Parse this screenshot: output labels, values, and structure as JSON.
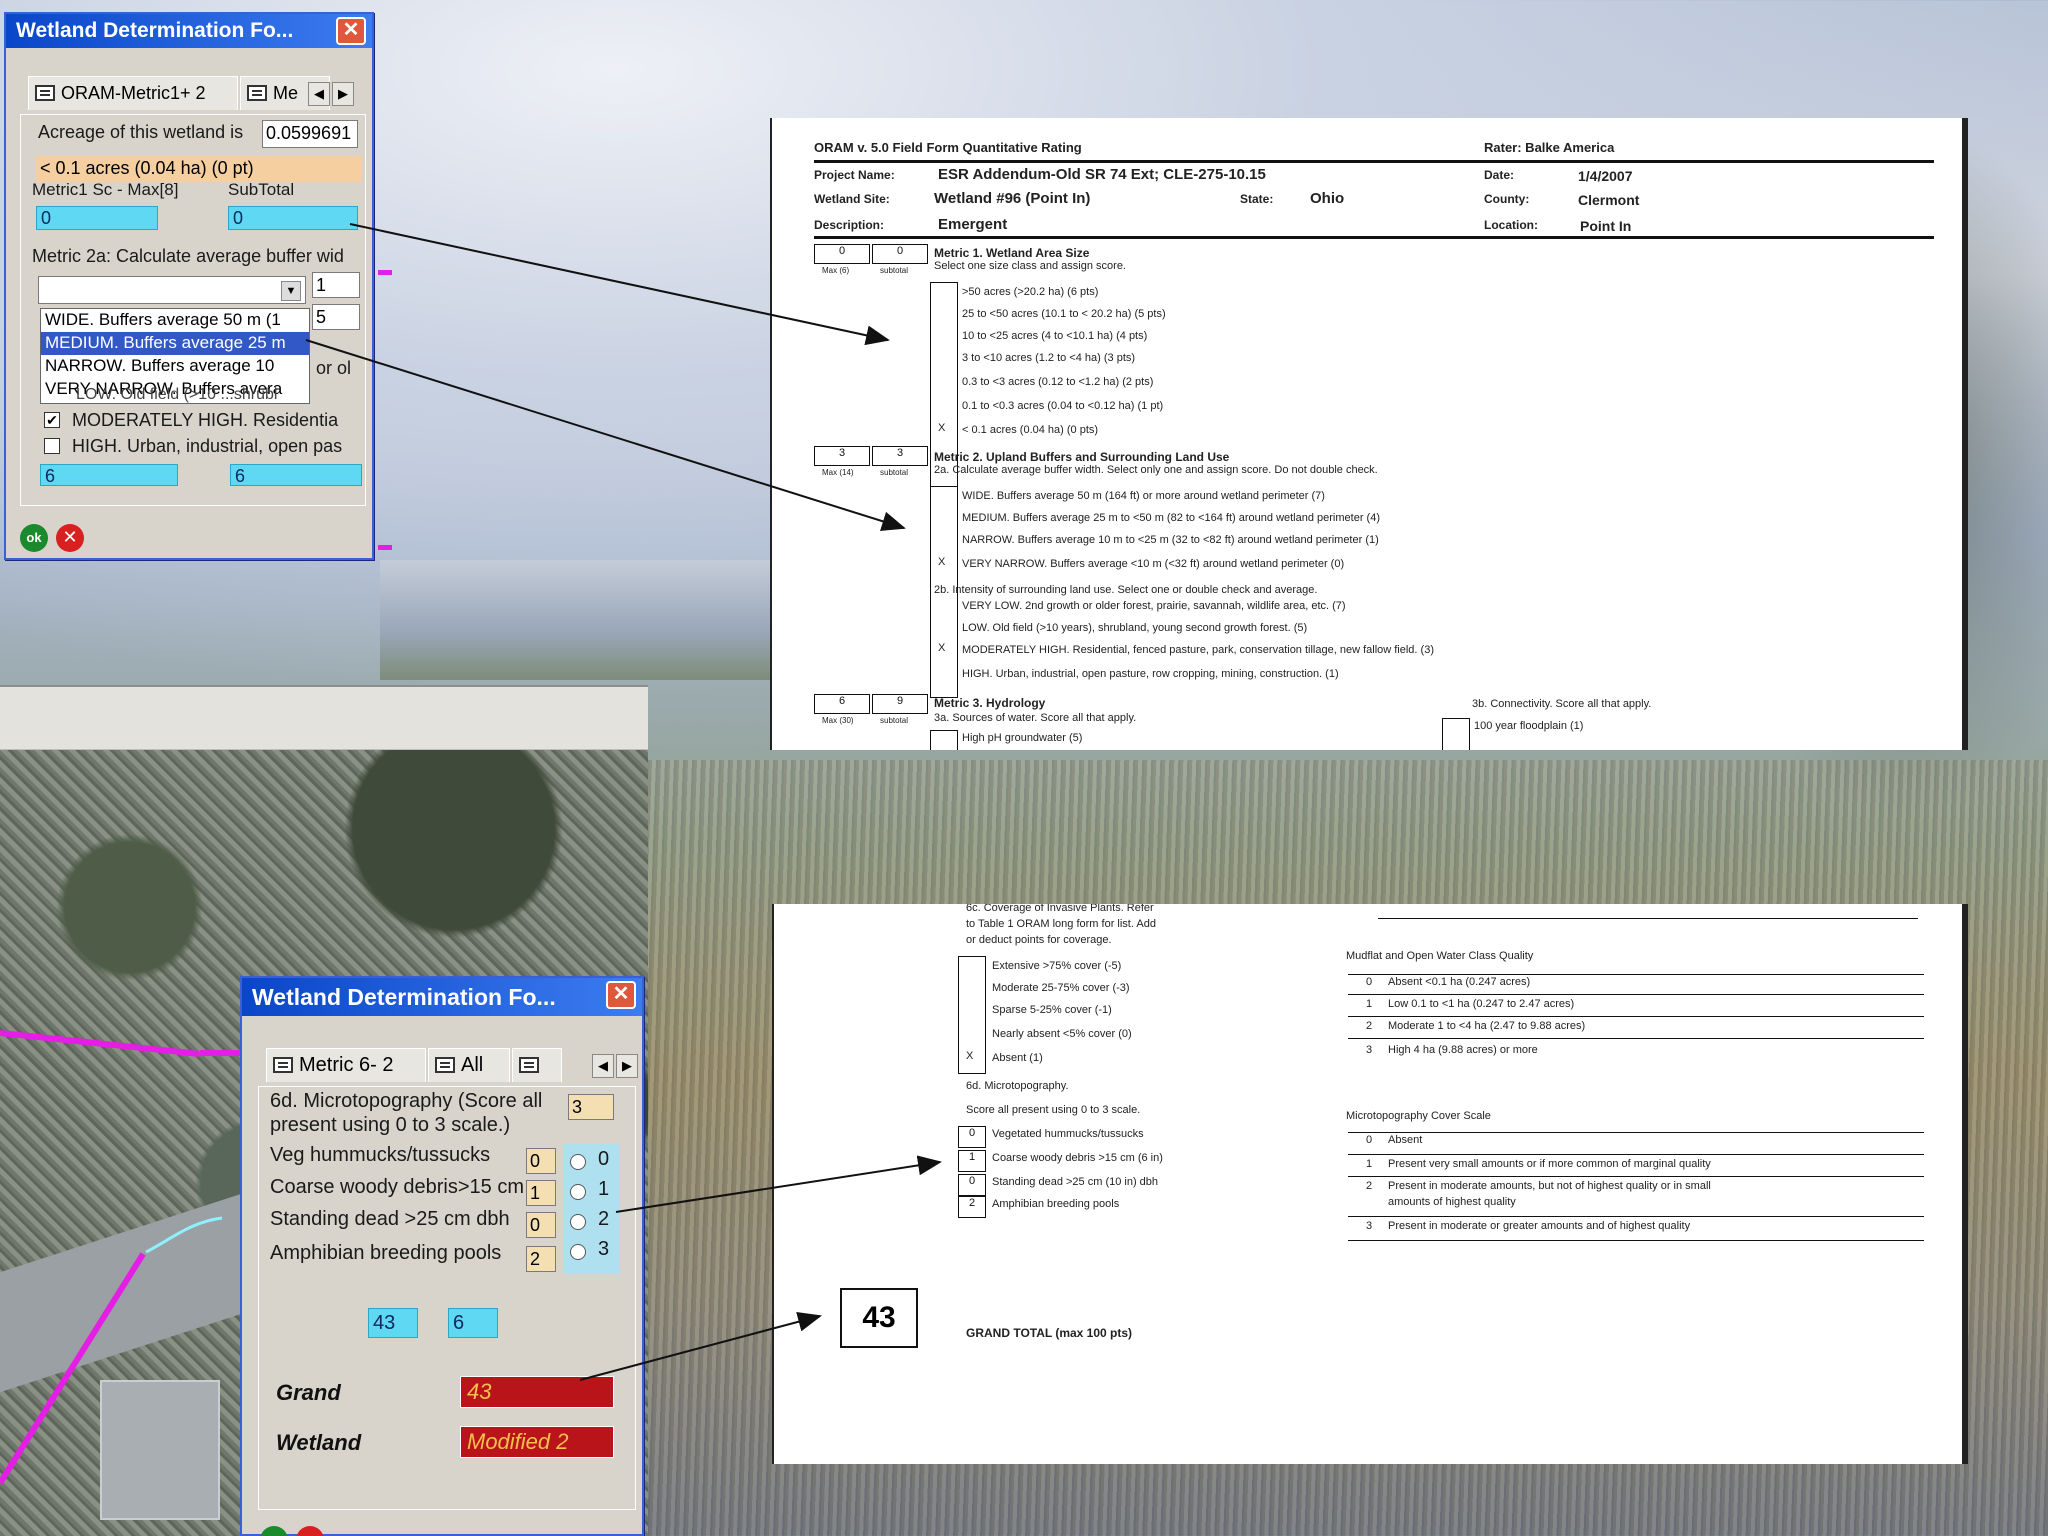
{
  "dialog1": {
    "title": "Wetland Determination Fo...",
    "close": "✕",
    "tab1": "ORAM-Metric1+ 2",
    "tab2": "Me",
    "acreage_label": "Acreage of this wetland is",
    "acreage_value": "0.0599691",
    "size_class": "< 0.1 acres (0.04 ha) (0 pt)",
    "m1_max_label": "Metric1 Sc - Max[8]",
    "subtotal_label": "SubTotal",
    "m1_score": "0",
    "subtotal_score": "0",
    "m2a_label": "Metric 2a: Calculate average buffer wid",
    "m2a_small1": "1",
    "m2a_small2": "5",
    "buffer_options": [
      "WIDE. Buffers average 50 m (1",
      "MEDIUM. Buffers average 25 m",
      "NARROW. Buffers average 10",
      "VERY NARROW. Buffers avera"
    ],
    "or_text": "or ol",
    "obscured_text": "LOW. Old field (>10 ...shrubl",
    "check1": "MODERATELY HIGH. Residentia",
    "check2": "HIGH. Urban, industrial, open pas",
    "score_a": "6",
    "score_b": "6",
    "ok": "ok",
    "cancel": "✕"
  },
  "dialog2": {
    "title": "Wetland Determination Fo...",
    "close": "✕",
    "tab1": "Metric 6- 2",
    "tab2": "All",
    "micro_label_1": "6d. Microtopography (Score all",
    "micro_label_2": "present using 0 to 3 scale.)",
    "micro_value": "3",
    "rows": [
      {
        "label": "Veg hummucks/tussucks",
        "value": "0",
        "radio": "0"
      },
      {
        "label": "Coarse woody debris>15 cm",
        "value": "1",
        "radio": "1"
      },
      {
        "label": "Standing dead >25 cm dbh",
        "value": "0",
        "radio": "2"
      },
      {
        "label": "Amphibian breeding pools",
        "value": "2",
        "radio": "3"
      }
    ],
    "total_a": "43",
    "total_b": "6",
    "grand_label": "Grand",
    "grand_value": "43",
    "wetland_label": "Wetland",
    "wetland_value": "Modified 2"
  },
  "form1": {
    "header": "ORAM v. 5.0 Field Form Quantitative Rating",
    "rater": "Rater: Balke America",
    "project_label": "Project Name:",
    "project_value": "ESR Addendum-Old SR 74 Ext; CLE-275-10.15",
    "date_label": "Date:",
    "date_value": "1/4/2007",
    "site_label": "Wetland Site:",
    "site_value": "Wetland #96 (Point In)",
    "state_label": "State:",
    "state_value": "Ohio",
    "county_label": "County:",
    "county_value": "Clermont",
    "desc_label": "Description:",
    "desc_value": "Emergent",
    "location_label": "Location:",
    "location_value": "Point In",
    "m1_box_a": "0",
    "m1_box_b": "0",
    "box_caption_a": "Max (6)",
    "box_caption_b": "subtotal",
    "m1_title": "Metric 1. Wetland Area Size",
    "m1_sub": "Select one size class and assign score.",
    "m1_items": [
      ">50 acres (>20.2 ha) (6 pts)",
      "25 to <50 acres (10.1 to < 20.2 ha) (5 pts)",
      "10 to <25 acres (4 to <10.1 ha) (4 pts)",
      "3 to <10 acres (1.2 to <4 ha) (3 pts)",
      "0.3 to <3 acres (0.12 to <1.2 ha) (2 pts)",
      "0.1 to <0.3 acres (0.04 to <0.12 ha) (1 pt)",
      "< 0.1 acres (0.04 ha) (0 pts)"
    ],
    "m1_mark": "X",
    "m2_box_a": "3",
    "m2_box_b": "3",
    "box_caption_m2": "Max (14)",
    "m2_title": "Metric 2. Upland Buffers and Surrounding Land Use",
    "m2_sub": "2a. Calculate average buffer width. Select only one and assign score. Do not double check.",
    "m2a_items": [
      "WIDE. Buffers average 50 m (164 ft) or more around wetland perimeter (7)",
      "MEDIUM. Buffers average 25 m to <50 m (82 to <164 ft) around wetland perimeter (4)",
      "NARROW. Buffers average 10 m to <25 m (32 to <82 ft) around wetland perimeter (1)",
      "VERY NARROW. Buffers average <10 m (<32 ft) around wetland perimeter (0)"
    ],
    "m2b_sub": "2b. Intensity of surrounding land use. Select one or double check and average.",
    "m2b_items": [
      "VERY LOW. 2nd growth or older forest, prairie, savannah, wildlife area, etc. (7)",
      "LOW. Old field (>10 years), shrubland, young second growth forest. (5)",
      "MODERATELY HIGH. Residential, fenced pasture, park, conservation tillage, new fallow field. (3)",
      "HIGH. Urban, industrial, open pasture, row cropping, mining, construction. (1)"
    ],
    "m3_box_a": "6",
    "m3_box_b": "9",
    "box_caption_m3": "Max (30)",
    "m3_title": "Metric 3. Hydrology",
    "m3_sub": "3a. Sources of water. Score all that apply.",
    "m3_item": "High pH groundwater (5)",
    "m3c_sub": "3b. Connectivity. Score all that apply.",
    "m3c_item": "100 year floodplain (1)"
  },
  "form2": {
    "m6c_lines": [
      "6c. Coverage of Invasive Plants. Refer",
      "to Table 1 ORAM long form for list. Add",
      "or deduct points for coverage."
    ],
    "m6c_items": [
      "Extensive >75% cover (-5)",
      "Moderate 25-75% cover (-3)",
      "Sparse 5-25% cover (-1)",
      "Nearly absent <5% cover (0)",
      "Absent (1)"
    ],
    "m6c_mark": "X",
    "m6d_title": "6d. Microtopography.",
    "m6d_sub": "Score all present using 0 to 3 scale.",
    "m6d_items": [
      {
        "score": "0",
        "label": "Vegetated hummucks/tussucks"
      },
      {
        "score": "1",
        "label": "Coarse woody debris >15 cm (6 in)"
      },
      {
        "score": "0",
        "label": "Standing dead >25 cm (10 in) dbh"
      },
      {
        "score": "2",
        "label": "Amphibian breeding pools"
      }
    ],
    "mudflat_title": "Mudflat and Open Water Class Quality",
    "mudflat_items": [
      {
        "n": "0",
        "t": "Absent <0.1 ha (0.247 acres)"
      },
      {
        "n": "1",
        "t": "Low 0.1 to <1 ha (0.247 to 2.47 acres)"
      },
      {
        "n": "2",
        "t": "Moderate 1 to <4 ha (2.47 to 9.88 acres)"
      },
      {
        "n": "3",
        "t": "High 4 ha (9.88 acres) or more"
      }
    ],
    "micro_scale_title": "Microtopography Cover Scale",
    "micro_scale_items": [
      {
        "n": "0",
        "t": "Absent"
      },
      {
        "n": "1",
        "t": "Present very small amounts or if more common of marginal quality"
      },
      {
        "n": "2",
        "t": "Present in moderate amounts, but not of highest quality or in small"
      },
      {
        "n": "",
        "t": "amounts of highest quality"
      },
      {
        "n": "3",
        "t": "Present in moderate or greater amounts and of highest quality"
      }
    ],
    "grand_total_value": "43",
    "grand_total_label": "GRAND TOTAL (max 100 pts)"
  }
}
